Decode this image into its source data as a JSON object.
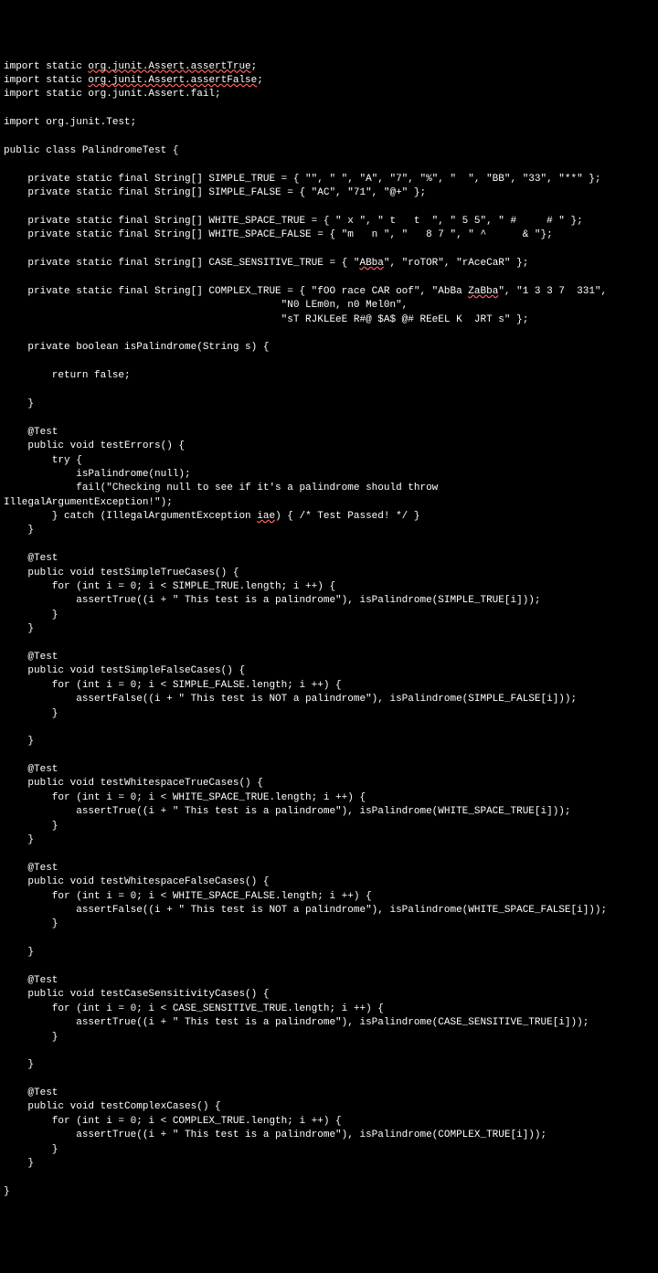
{
  "lines": [
    "import static org.junit.Assert.assertTrue;",
    "import static org.junit.Assert.assertFalse;",
    "import static org.junit.Assert.fail;",
    "",
    "import org.junit.Test;",
    "",
    "public class PalindromeTest {",
    "",
    "    private static final String[] SIMPLE_TRUE = { \"\", \" \", \"A\", \"7\", \"%\", \"  \", \"BB\", \"33\", \"**\" };",
    "    private static final String[] SIMPLE_FALSE = { \"AC\", \"71\", \"@+\" };",
    "",
    "    private static final String[] WHITE_SPACE_TRUE = { \" x \", \" t   t  \", \" 5 5\", \" #     # \" };",
    "    private static final String[] WHITE_SPACE_FALSE = { \"m   n \", \"   8 7 \", \" ^      & \"};",
    "",
    "    private static final String[] CASE_SENSITIVE_TRUE = { \"ABba\", \"roTOR\", \"rAceCaR\" };",
    "",
    "    private static final String[] COMPLEX_TRUE = { \"fOO race CAR oof\", \"AbBa ZaBba\", \"1 3 3 7  331\",",
    "                                              \"N0 LEm0n, n0 Mel0n\",",
    "                                              \"sT RJKLEeE R#@ $A$ @# REeEL K  JRT s\" };",
    "",
    "    private boolean isPalindrome(String s) {",
    "",
    "        return false;",
    "",
    "    }",
    "",
    "    @Test",
    "    public void testErrors() {",
    "        try {",
    "            isPalindrome(null);",
    "            fail(\"Checking null to see if it's a palindrome should throw",
    "IllegalArgumentException!\");",
    "        } catch (IllegalArgumentException iae) { /* Test Passed! */ }",
    "    }",
    "",
    "    @Test",
    "    public void testSimpleTrueCases() {",
    "        for (int i = 0; i < SIMPLE_TRUE.length; i ++) {",
    "            assertTrue((i + \" This test is a palindrome\"), isPalindrome(SIMPLE_TRUE[i]));",
    "        }",
    "    }",
    "",
    "    @Test",
    "    public void testSimpleFalseCases() {",
    "        for (int i = 0; i < SIMPLE_FALSE.length; i ++) {",
    "            assertFalse((i + \" This test is NOT a palindrome\"), isPalindrome(SIMPLE_FALSE[i]));",
    "        }",
    "",
    "    }",
    "",
    "    @Test",
    "    public void testWhitespaceTrueCases() {",
    "        for (int i = 0; i < WHITE_SPACE_TRUE.length; i ++) {",
    "            assertTrue((i + \" This test is a palindrome\"), isPalindrome(WHITE_SPACE_TRUE[i]));",
    "        }",
    "    }",
    "",
    "    @Test",
    "    public void testWhitespaceFalseCases() {",
    "        for (int i = 0; i < WHITE_SPACE_FALSE.length; i ++) {",
    "            assertFalse((i + \" This test is NOT a palindrome\"), isPalindrome(WHITE_SPACE_FALSE[i]));",
    "        }",
    "",
    "    }",
    "",
    "    @Test",
    "    public void testCaseSensitivityCases() {",
    "        for (int i = 0; i < CASE_SENSITIVE_TRUE.length; i ++) {",
    "            assertTrue((i + \" This test is a palindrome\"), isPalindrome(CASE_SENSITIVE_TRUE[i]));",
    "        }",
    "",
    "    }",
    "",
    "    @Test",
    "    public void testComplexCases() {",
    "        for (int i = 0; i < COMPLEX_TRUE.length; i ++) {",
    "            assertTrue((i + \" This test is a palindrome\"), isPalindrome(COMPLEX_TRUE[i]));",
    "        }",
    "    }",
    "",
    "}"
  ],
  "underlined_tokens": {
    "0": [
      "org.junit.Assert.assertTrue"
    ],
    "1": [
      "org.junit.Assert.assertFalse"
    ],
    "14": [
      "ABba"
    ],
    "16": [
      "ZaBba"
    ],
    "32": [
      "iae"
    ]
  }
}
